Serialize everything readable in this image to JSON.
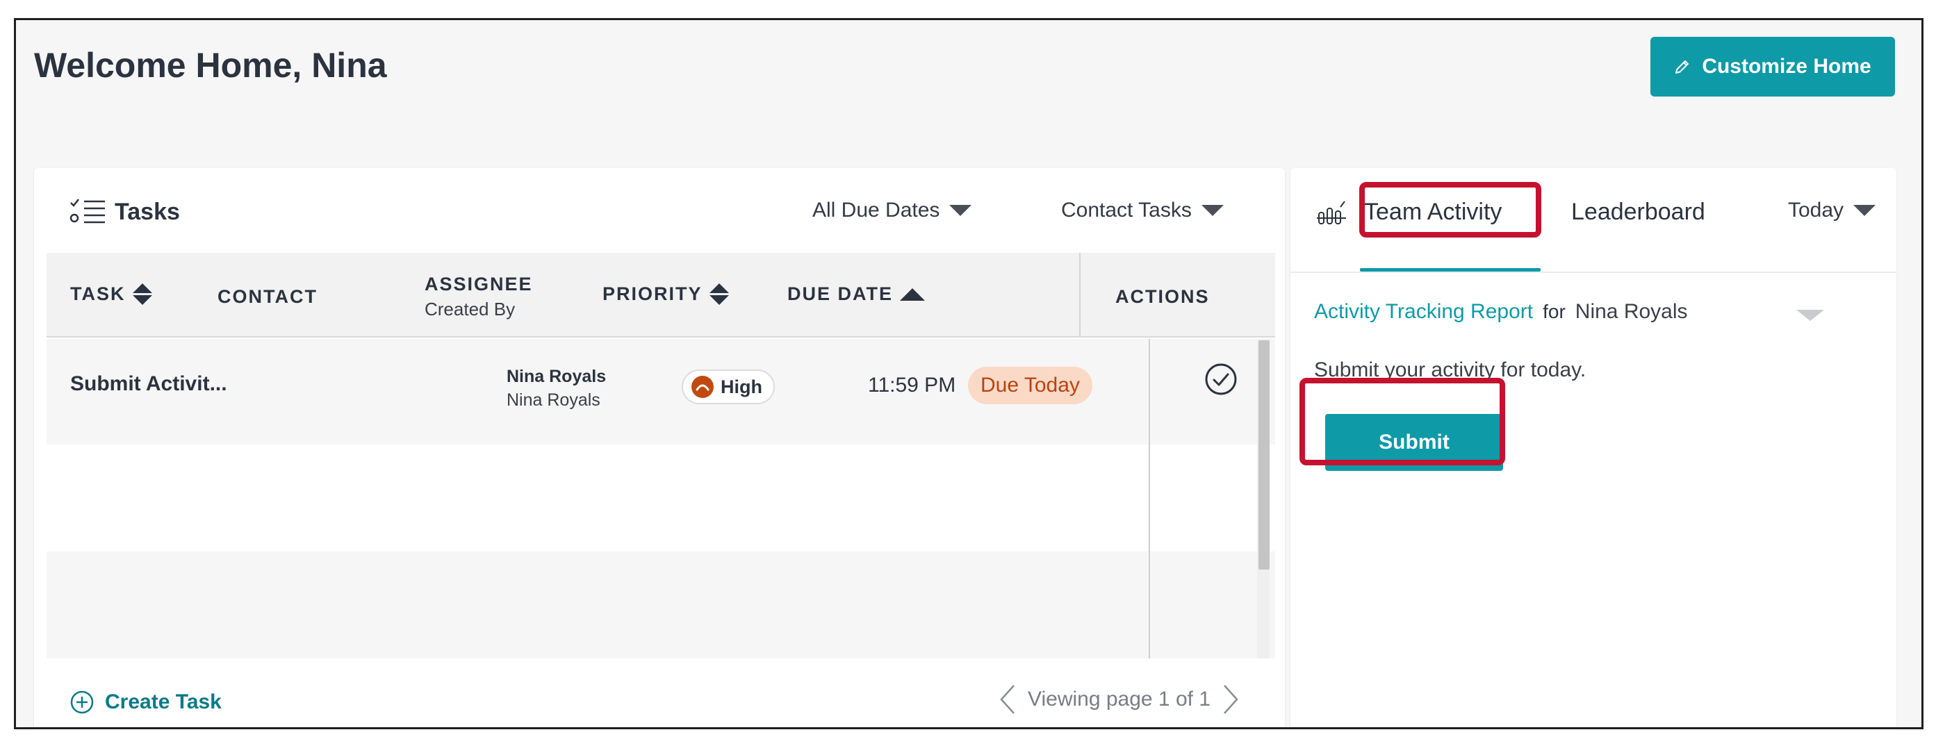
{
  "page": {
    "title": "Welcome Home, Nina",
    "customize_label": "Customize Home"
  },
  "tasks": {
    "title": "Tasks",
    "filters": {
      "due_dates": "All Due Dates",
      "task_type": "Contact Tasks"
    },
    "columns": {
      "task": "TASK",
      "contact": "CONTACT",
      "assignee": "ASSIGNEE",
      "assignee_sub": "Created By",
      "priority": "PRIORITY",
      "due_date": "DUE DATE",
      "actions": "ACTIONS"
    },
    "rows": [
      {
        "task": "Submit Activit...",
        "contact": "",
        "assignee": "Nina Royals",
        "created_by": "Nina Royals",
        "priority": "High",
        "due_time": "11:59 PM",
        "due_badge": "Due Today"
      }
    ],
    "create_label": "Create Task",
    "pager": "Viewing page 1 of 1"
  },
  "activity": {
    "tabs": {
      "team": "Team Activity",
      "leaderboard": "Leaderboard"
    },
    "period": "Today",
    "report_link": "Activity Tracking Report",
    "report_for": "for",
    "report_user": "Nina Royals",
    "prompt": "Submit your activity for today.",
    "submit_label": "Submit"
  },
  "colors": {
    "accent": "#0e9aa7",
    "priority_high": "#c24a0f",
    "due_badge_bg": "#fbd9c7",
    "due_badge_text": "#b8430f",
    "highlight": "#c4122f"
  },
  "icons": [
    "pencil-icon",
    "tasks-list-icon",
    "caret-down-icon",
    "sort-icon",
    "sort-asc-icon",
    "priority-high-icon",
    "check-circle-icon",
    "plus-circle-icon",
    "chevron-left-icon",
    "chevron-right-icon",
    "activity-chart-icon"
  ]
}
